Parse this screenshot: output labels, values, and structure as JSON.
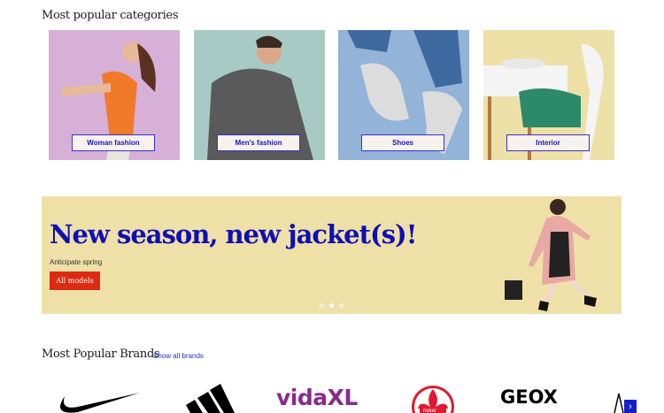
{
  "categories_section": {
    "title": "Most popular categories",
    "items": [
      {
        "label": "Woman fashion",
        "bg": "#d6b0d6"
      },
      {
        "label": "Men's fashion",
        "bg": "#a7cbc4"
      },
      {
        "label": "Shoes",
        "bg": "#93b3d8"
      },
      {
        "label": "Interior",
        "bg": "#ede0a6"
      }
    ]
  },
  "banner": {
    "headline": "New season, new jacket(s)!",
    "subtitle": "Anticipate spring",
    "button": "All models",
    "slides": 3,
    "active_slide": 2
  },
  "brands_section": {
    "title": "Most Popular Brands",
    "show_all": "Show all brands",
    "brands": [
      "Nike",
      "Adidas",
      "vidaXL",
      "Rieker",
      "GEOX"
    ],
    "next_icon": "›"
  }
}
